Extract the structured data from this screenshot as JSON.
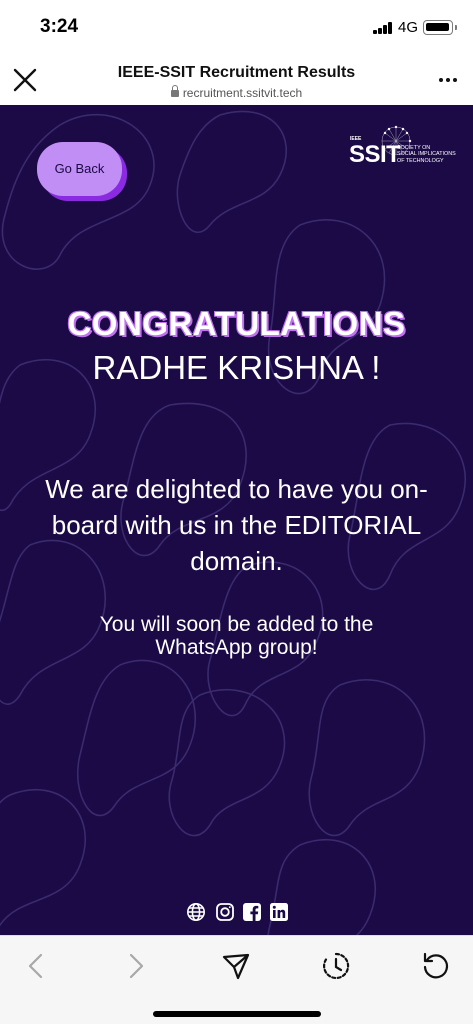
{
  "status_bar": {
    "time": "3:24",
    "network": "4G",
    "icons": [
      "signal-icon",
      "battery-icon"
    ]
  },
  "browser": {
    "title": "IEEE-SSIT Recruitment Results",
    "url": "recruitment.ssitvit.tech",
    "icons": [
      "close-icon",
      "lock-icon",
      "more-icon"
    ]
  },
  "page": {
    "go_back_label": "Go Back",
    "logo": {
      "ieee": "IEEE",
      "ssit": "SSIT",
      "subtitle_lines": [
        "SOCIETY ON",
        "SOCIAL IMPLICATIONS",
        "OF TECHNOLOGY"
      ]
    },
    "congrats": "CONGRATULATIONS",
    "name": "RADHE KRISHNA !",
    "message": "We are delighted to have you on-board with us in the EDITORIAL domain.",
    "whatsapp_note": "You will soon be added to the WhatsApp group!",
    "social_icons": [
      "globe-icon",
      "instagram-icon",
      "facebook-icon",
      "linkedin-icon"
    ],
    "colors": {
      "background": "#1b0a45",
      "button": "#c08ef5",
      "button_shadow": "#8a2be2",
      "accent_text": "#c070f0",
      "text": "#ffffff"
    }
  },
  "toolbar": {
    "icons": [
      "back-arrow-icon",
      "forward-arrow-icon",
      "share-icon",
      "history-icon",
      "reload-icon"
    ]
  }
}
